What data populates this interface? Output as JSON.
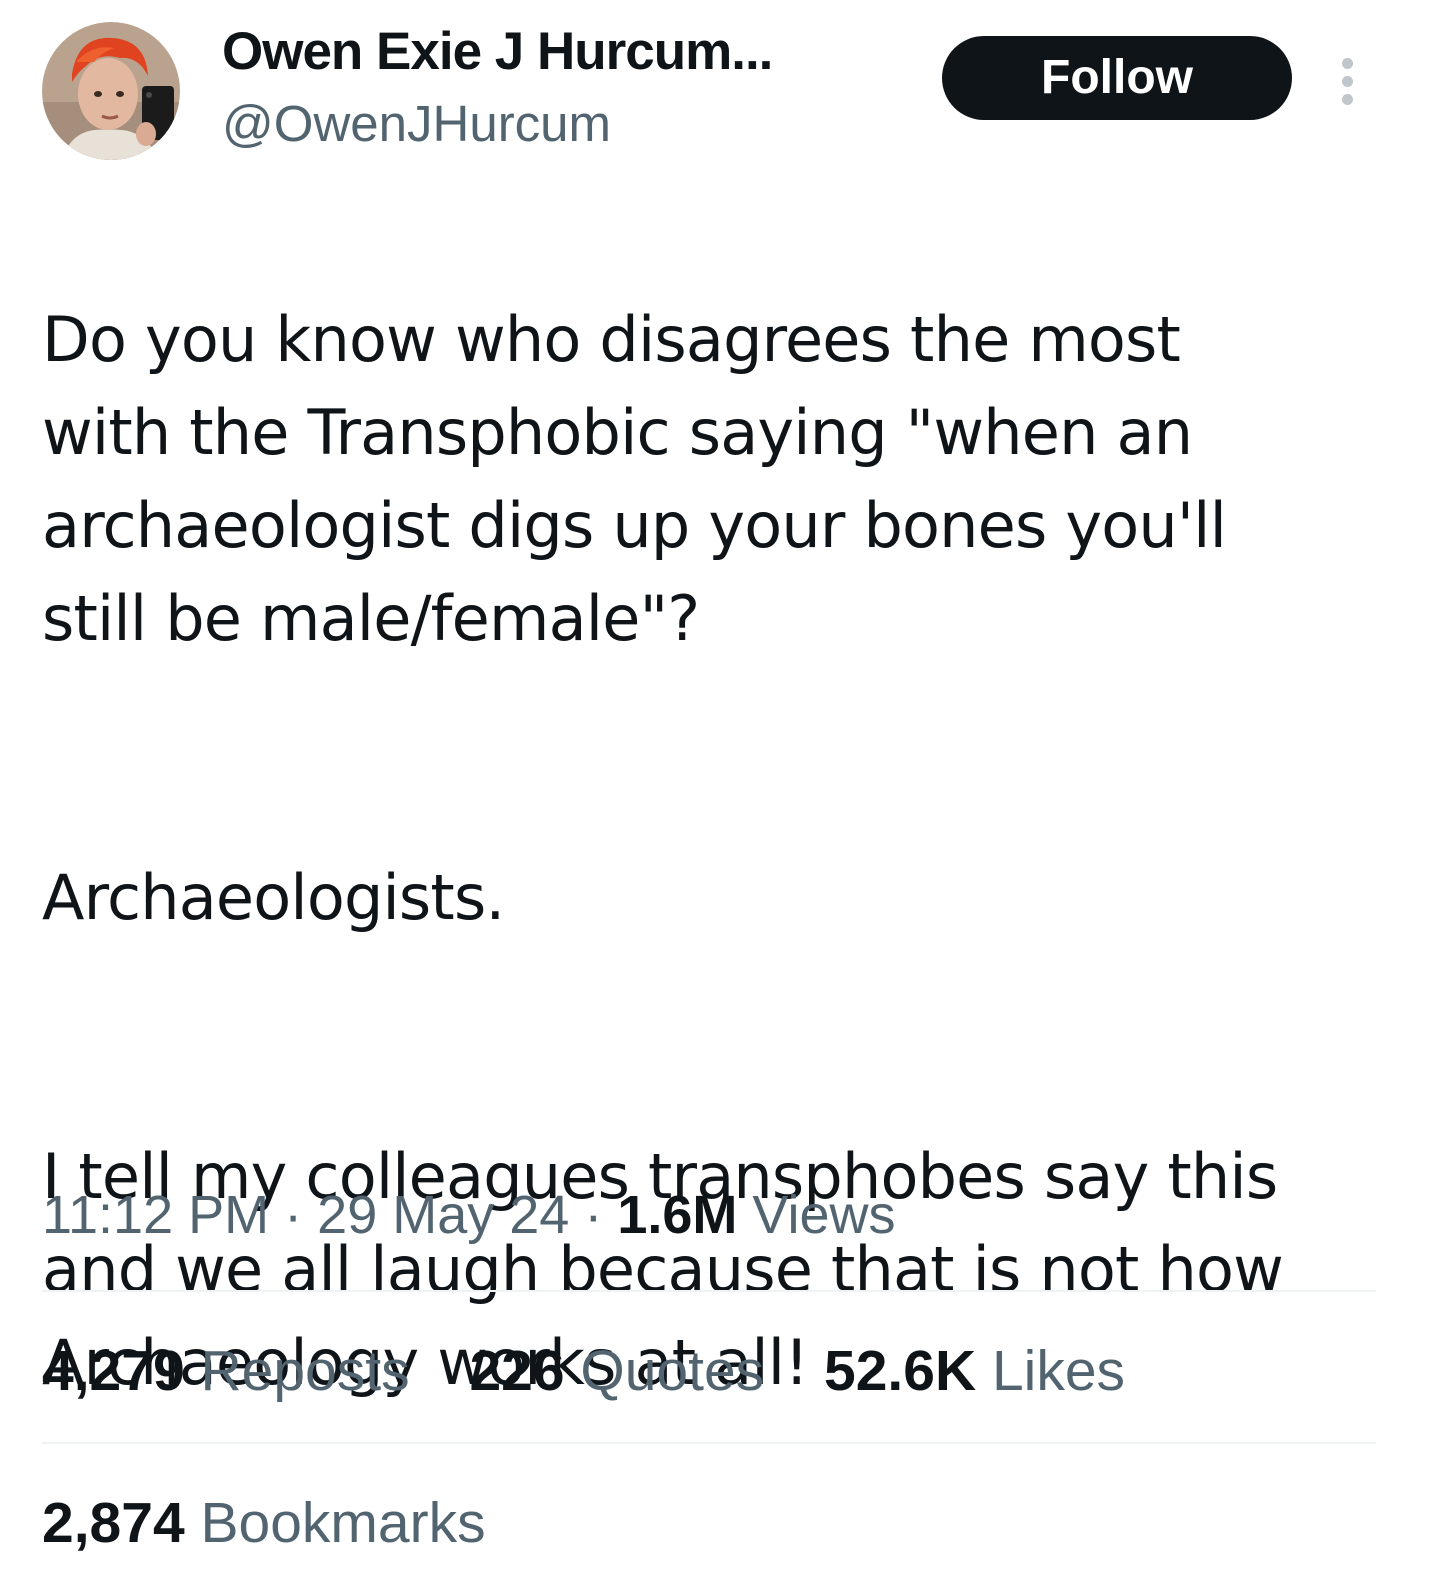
{
  "author": {
    "display_name": "Owen Exie J Hurcum...",
    "handle": "@OwenJHurcum",
    "avatar_icon": "profile-photo"
  },
  "actions": {
    "follow_label": "Follow",
    "more_icon": "more-vertical-icon"
  },
  "tweet": {
    "paragraphs": [
      "Do you know who disagrees the most\nwith the Transphobic saying \"when an\narchaeologist digs up your bones you'll\nstill be male/female\"?",
      "Archaeologists.",
      "I tell my colleagues transphobes say this\nand we all laugh because that is not how\nArchaeology works at all!"
    ]
  },
  "meta": {
    "time": "11:12 PM",
    "date": "29 May 24",
    "separator": "·",
    "views_count": "1.6M",
    "views_label": "Views"
  },
  "stats": {
    "reposts_count": "4,279",
    "reposts_label": "Reposts",
    "quotes_count": "226",
    "quotes_label": "Quotes",
    "likes_count": "52.6K",
    "likes_label": "Likes",
    "bookmarks_count": "2,874",
    "bookmarks_label": "Bookmarks"
  },
  "colors": {
    "text_primary": "#0f1419",
    "text_secondary": "#536471",
    "button_bg": "#0f1419",
    "divider": "#eff3f4"
  }
}
